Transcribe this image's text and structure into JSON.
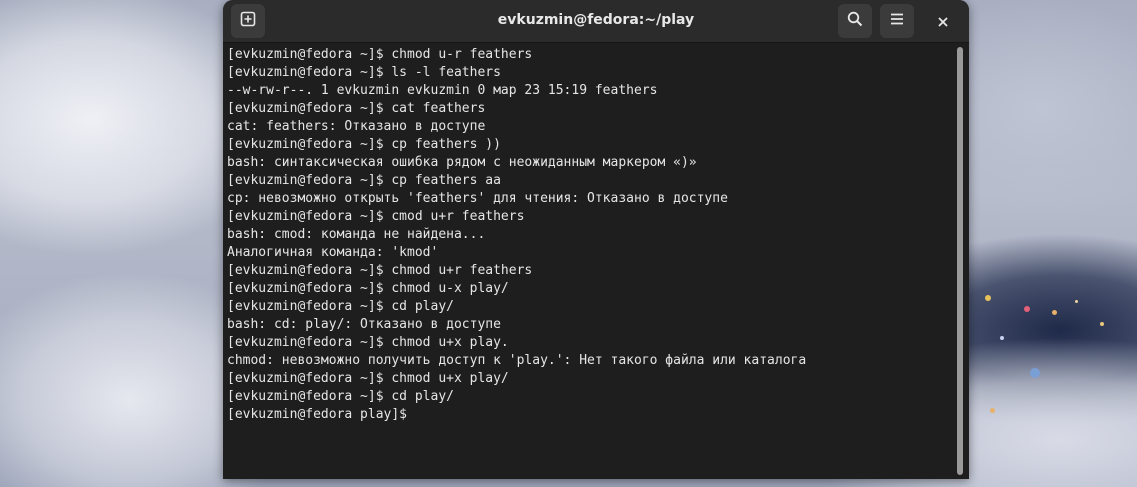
{
  "window": {
    "title": "evkuzmin@fedora:~/play"
  },
  "icons": {
    "new_tab": "new-tab-icon",
    "search": "search-icon",
    "menu": "hamburger-menu-icon",
    "close": "close-icon"
  },
  "colors": {
    "terminal_bg": "#1e1e1e",
    "titlebar_bg": "#2b2b2b",
    "text": "#e6e6e6"
  },
  "terminal": {
    "lines": [
      "[evkuzmin@fedora ~]$ chmod u-r feathers",
      "[evkuzmin@fedora ~]$ ls -l feathers",
      "--w-rw-r--. 1 evkuzmin evkuzmin 0 мар 23 15:19 feathers",
      "[evkuzmin@fedora ~]$ cat feathers",
      "cat: feathers: Отказано в доступе",
      "[evkuzmin@fedora ~]$ cp feathers ))",
      "bash: синтаксическая ошибка рядом с неожиданным маркером «)»",
      "[evkuzmin@fedora ~]$ cp feathers aa",
      "cp: невозможно открыть 'feathers' для чтения: Отказано в доступе",
      "[evkuzmin@fedora ~]$ cmod u+r feathers",
      "bash: cmod: команда не найдена...",
      "Аналогичная команда: 'kmod'",
      "[evkuzmin@fedora ~]$ chmod u+r feathers",
      "[evkuzmin@fedora ~]$ chmod u-x play/",
      "[evkuzmin@fedora ~]$ cd play/",
      "bash: cd: play/: Отказано в доступе",
      "[evkuzmin@fedora ~]$ chmod u+x play.",
      "chmod: невозможно получить доступ к 'play.': Нет такого файла или каталога",
      "[evkuzmin@fedora ~]$ chmod u+x play/",
      "[evkuzmin@fedora ~]$ cd play/",
      "[evkuzmin@fedora play]$"
    ]
  }
}
